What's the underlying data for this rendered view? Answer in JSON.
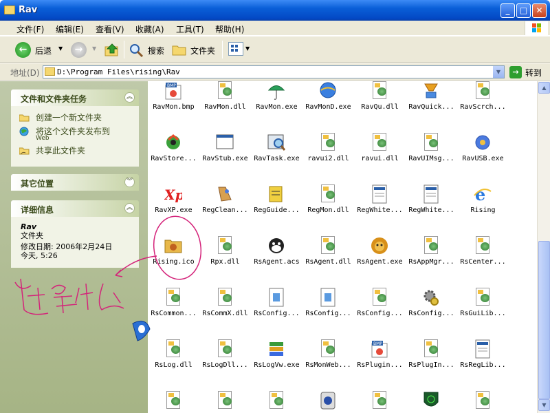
{
  "window": {
    "title": "Rav"
  },
  "menu": [
    "文件(F)",
    "编辑(E)",
    "查看(V)",
    "收藏(A)",
    "工具(T)",
    "帮助(H)"
  ],
  "toolbar": {
    "back": "后退",
    "search": "搜索",
    "folders": "文件夹"
  },
  "address": {
    "label": "地址(D)",
    "path": "D:\\Program Files\\rising\\Rav",
    "go": "转到"
  },
  "tasks_panel": {
    "title": "文件和文件夹任务",
    "items": [
      "创建一个新文件夹",
      "将这个文件夹发布到",
      "Web",
      "共享此文件夹"
    ]
  },
  "other_panel": {
    "title": "其它位置"
  },
  "details_panel": {
    "title": "详细信息",
    "name": "Rav",
    "type": "文件夹",
    "modified": "修改日期: 2006年2月24日",
    "today": "今天, 5:26"
  },
  "files": [
    {
      "name": "RavMon.bmp",
      "icon": "bmp"
    },
    {
      "name": "RavMon.dll",
      "icon": "dll"
    },
    {
      "name": "RavMon.exe",
      "icon": "umbrella"
    },
    {
      "name": "RavMonD.exe",
      "icon": "globe"
    },
    {
      "name": "RavQu.dll",
      "icon": "dll"
    },
    {
      "name": "RavQuick...",
      "icon": "quick"
    },
    {
      "name": "RavScrch...",
      "icon": "dll"
    },
    {
      "name": "RavStore...",
      "icon": "recycle"
    },
    {
      "name": "RavStub.exe",
      "icon": "window"
    },
    {
      "name": "RavTask.exe",
      "icon": "task"
    },
    {
      "name": "ravui2.dll",
      "icon": "dll"
    },
    {
      "name": "ravui.dll",
      "icon": "dll"
    },
    {
      "name": "RavUIMsg...",
      "icon": "dll"
    },
    {
      "name": "RavUSB.exe",
      "icon": "usb"
    },
    {
      "name": "RavXP.exe",
      "icon": "xp"
    },
    {
      "name": "RegClean...",
      "icon": "clean"
    },
    {
      "name": "RegGuide...",
      "icon": "guide"
    },
    {
      "name": "RegMon.dll",
      "icon": "dll"
    },
    {
      "name": "RegWhite...",
      "icon": "doc"
    },
    {
      "name": "RegWhite...",
      "icon": "doc"
    },
    {
      "name": "Rising",
      "icon": "ie"
    },
    {
      "name": "Rising.ico",
      "icon": "ico"
    },
    {
      "name": "Rpx.dll",
      "icon": "dll"
    },
    {
      "name": "RsAgent.acs",
      "icon": "dog"
    },
    {
      "name": "RsAgent.dll",
      "icon": "dll"
    },
    {
      "name": "RsAgent.exe",
      "icon": "lion"
    },
    {
      "name": "RsAppMgr...",
      "icon": "dll"
    },
    {
      "name": "RsCenter...",
      "icon": "dll"
    },
    {
      "name": "RsCommon...",
      "icon": "dll"
    },
    {
      "name": "RsCommX.dll",
      "icon": "dll"
    },
    {
      "name": "RsConfig...",
      "icon": "cfg"
    },
    {
      "name": "RsConfig...",
      "icon": "cfg"
    },
    {
      "name": "RsConfig...",
      "icon": "dll"
    },
    {
      "name": "RsConfig...",
      "icon": "gear"
    },
    {
      "name": "RsGuiLib...",
      "icon": "dll"
    },
    {
      "name": "RsLog.dll",
      "icon": "dll"
    },
    {
      "name": "RsLogDll...",
      "icon": "dll"
    },
    {
      "name": "RsLogVw.exe",
      "icon": "books"
    },
    {
      "name": "RsMonWeb...",
      "icon": "dll"
    },
    {
      "name": "RsPlugin...",
      "icon": "bmp"
    },
    {
      "name": "RsPlugIn...",
      "icon": "dll"
    },
    {
      "name": "RsRegLib...",
      "icon": "doc"
    },
    {
      "name": "",
      "icon": "dll"
    },
    {
      "name": "",
      "icon": "dll"
    },
    {
      "name": "",
      "icon": "dll"
    },
    {
      "name": "",
      "icon": "cd"
    },
    {
      "name": "",
      "icon": "dll"
    },
    {
      "name": "",
      "icon": "radar"
    },
    {
      "name": "",
      "icon": "dll"
    }
  ],
  "annotation": {
    "handwriting": "这是什么"
  }
}
